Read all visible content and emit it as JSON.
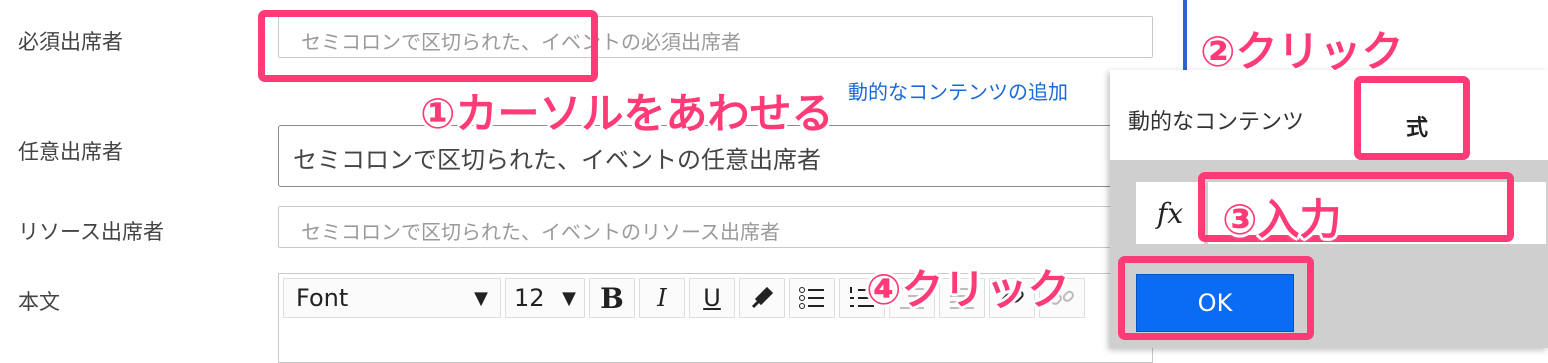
{
  "form": {
    "required_label": "必須出席者",
    "required_placeholder": "セミコロンで区切られた、イベントの必須出席者",
    "dynamic_link": "動的なコンテンツの追加",
    "optional_label": "任意出席者",
    "optional_placeholder": "セミコロンで区切られた、イベントの任意出席者",
    "resource_label": "リソース出席者",
    "resource_placeholder": "セミコロンで区切られた、イベントのリソース出席者",
    "body_label": "本文"
  },
  "toolbar": {
    "font": "Font",
    "font_caret": "▼",
    "size": "12",
    "size_caret": "▼",
    "bold": "B",
    "italic": "I",
    "underline": "U"
  },
  "popover": {
    "tab_dynamic": "動的なコンテンツ",
    "tab_expression": "式",
    "fx": "fx",
    "ok": "OK"
  },
  "annotations": {
    "step1": "①カーソルをあわせる",
    "step2": "②クリック",
    "step3": "③入力",
    "step4": "④クリック"
  },
  "colors": {
    "highlight": "#ff3b77",
    "ok_button": "#0a6cf5",
    "link": "#1a6ad6"
  }
}
